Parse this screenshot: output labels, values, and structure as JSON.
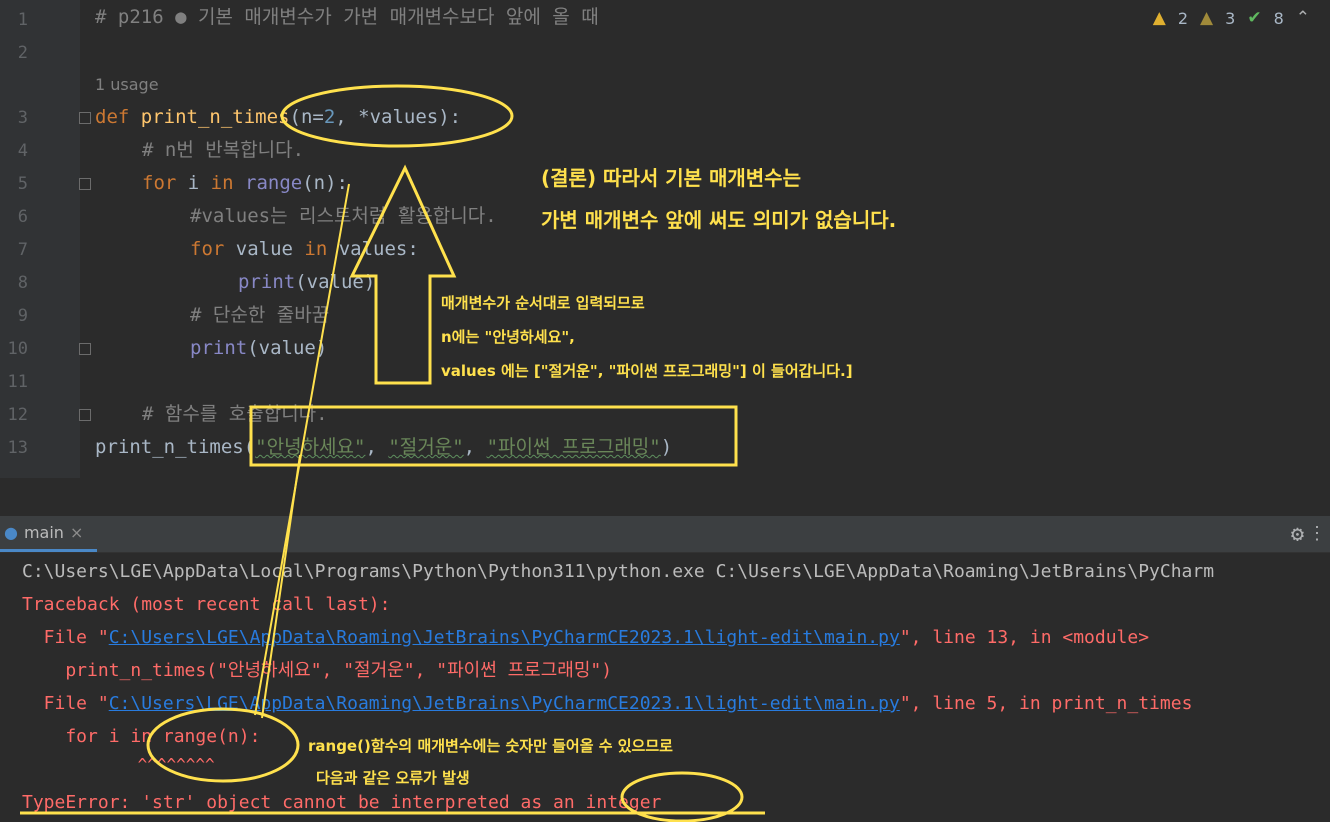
{
  "editor": {
    "line_numbers": [
      "1",
      "2",
      "3",
      "4",
      "5",
      "6",
      "7",
      "8",
      "9",
      "10",
      "11",
      "12",
      "13"
    ],
    "usage_hint": "1 usage",
    "inspections": {
      "warnings": "2",
      "weak_warnings": "3",
      "typos": "8"
    },
    "lines": {
      "l1": "# p216 ● 기본 매개변수가 가변 매개변수보다 앞에 올 때",
      "l3_def": "def",
      "l3_fn": "print_n_times",
      "l3_open": "(n=",
      "l3_num": "2",
      "l3_rest": ", *values):",
      "l4": "# n번 반복합니다.",
      "l5_for": "for",
      "l5_i": " i ",
      "l5_in": "in",
      "l5_range": "range",
      "l5_rest": "(n):",
      "l6": "#values는 리스트처럼 활용합니다.",
      "l7_for": "for",
      "l7_mid": " value ",
      "l7_in": "in",
      "l7_rest": " values:",
      "l8_print": "print",
      "l8_rest": "(value)",
      "l9": "# 단순한 줄바꿈",
      "l10_print": "print",
      "l10_rest": "(value)",
      "l12": "# 함수를 호출합니다.",
      "l13_fn": "print_n_times",
      "l13_open": "(",
      "l13_s1": "\"안녕하세요\"",
      "l13_c1": ", ",
      "l13_s2": "\"절거운\"",
      "l13_c2": ", ",
      "l13_s3": "\"파이썬 프로그래밍\"",
      "l13_close": ")"
    }
  },
  "run_panel": {
    "tab_label": "main",
    "close_glyph": "×",
    "lines": {
      "cmd": "C:\\Users\\LGE\\AppData\\Local\\Programs\\Python\\Python311\\python.exe C:\\Users\\LGE\\AppData\\Roaming\\JetBrains\\PyCharm",
      "tb": "Traceback (most recent call last):",
      "f1_pre": "  File \"",
      "f1_link": "C:\\Users\\LGE\\AppData\\Roaming\\JetBrains\\PyCharmCE2023.1\\light-edit\\main.py",
      "f1_post": "\", line 13, in <module>",
      "f1_code": "    print_n_times(\"안녕하세요\", \"절거운\", \"파이썬 프로그래밍\")",
      "f2_pre": "  File \"",
      "f2_link": "C:\\Users\\LGE\\AppData\\Roaming\\JetBrains\\PyCharmCE2023.1\\light-edit\\main.py",
      "f2_post": "\", line 5, in print_n_times",
      "f2_code": "    for i in range(n):",
      "carets": "            ^^^^^^^^",
      "err": "TypeError: 'str' object cannot be interpreted as an integer"
    }
  },
  "annotations": {
    "conclusion_1": "(결론) 따라서 기본 매개변수는",
    "conclusion_2": "가변 매개변수 앞에 써도 의미가 없습니다.",
    "order_1": "매개변수가 순서대로 입력되므로",
    "order_2": "n에는 \"안녕하세요\",",
    "order_3": "values 에는 [\"절거운\", \"파이썬 프로그래밍\"] 이 들어갑니다.]",
    "range_1": "range()함수의 매개변수에는 숫자만 들어올 수 있으므로",
    "range_2": "다음과 같은 오류가 발생"
  },
  "colors": {
    "annotation": "#ffe14d",
    "error_red": "#ff6b68",
    "link_blue": "#287bde"
  }
}
